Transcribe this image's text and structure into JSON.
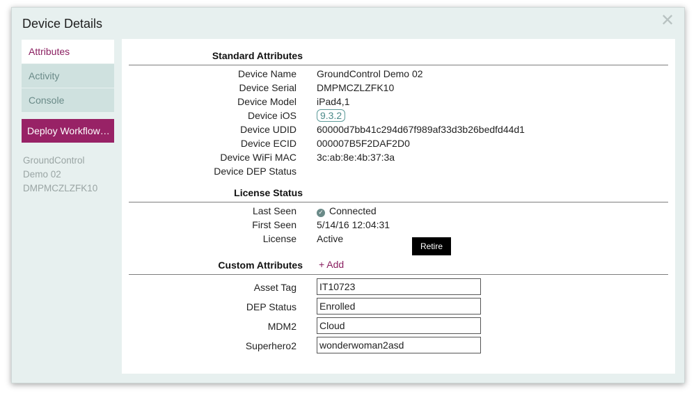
{
  "window": {
    "title": "Device Details"
  },
  "sidebar": {
    "items": [
      {
        "label": "Attributes",
        "active": true
      },
      {
        "label": "Activity",
        "active": false
      },
      {
        "label": "Console",
        "active": false
      }
    ],
    "deploy_label": "Deploy Workflow…",
    "device_summary": [
      "GroundControl",
      "Demo 02",
      "DMPMCZLZFK10"
    ]
  },
  "standard": {
    "title": "Standard Attributes",
    "rows": [
      {
        "label": "Device Name",
        "value": "GroundControl Demo 02"
      },
      {
        "label": "Device Serial",
        "value": "DMPMCZLZFK10"
      },
      {
        "label": "Device Model",
        "value": "iPad4,1"
      },
      {
        "label": "Device iOS",
        "value": "9.3.2"
      },
      {
        "label": "Device UDID",
        "value": "60000d7bb41c294d67f989af33d3b26bedfd44d1"
      },
      {
        "label": "Device ECID",
        "value": "000007B5F2DAF2D0"
      },
      {
        "label": "Device WiFi MAC",
        "value": "3c:ab:8e:4b:37:3a"
      },
      {
        "label": "Device DEP Status",
        "value": ""
      }
    ]
  },
  "license": {
    "title": "License Status",
    "rows": [
      {
        "label": "Last Seen",
        "value": "Connected"
      },
      {
        "label": "First Seen",
        "value": "5/14/16 12:04:31"
      },
      {
        "label": "License",
        "value": "Active"
      }
    ],
    "retire_label": "Retire"
  },
  "custom": {
    "title": "Custom Attributes",
    "add_label": "+ Add",
    "fields": [
      {
        "label": "Asset Tag",
        "value": "IT10723"
      },
      {
        "label": "DEP Status",
        "value": "Enrolled"
      },
      {
        "label": "MDM2",
        "value": "Cloud"
      },
      {
        "label": "Superhero2",
        "value": "wonderwoman2asd"
      }
    ]
  },
  "colors": {
    "accent": "#982266",
    "nav_bg": "#cfe1df",
    "modal_bg": "#e7f0ef",
    "badge": "#5d9b9a"
  }
}
